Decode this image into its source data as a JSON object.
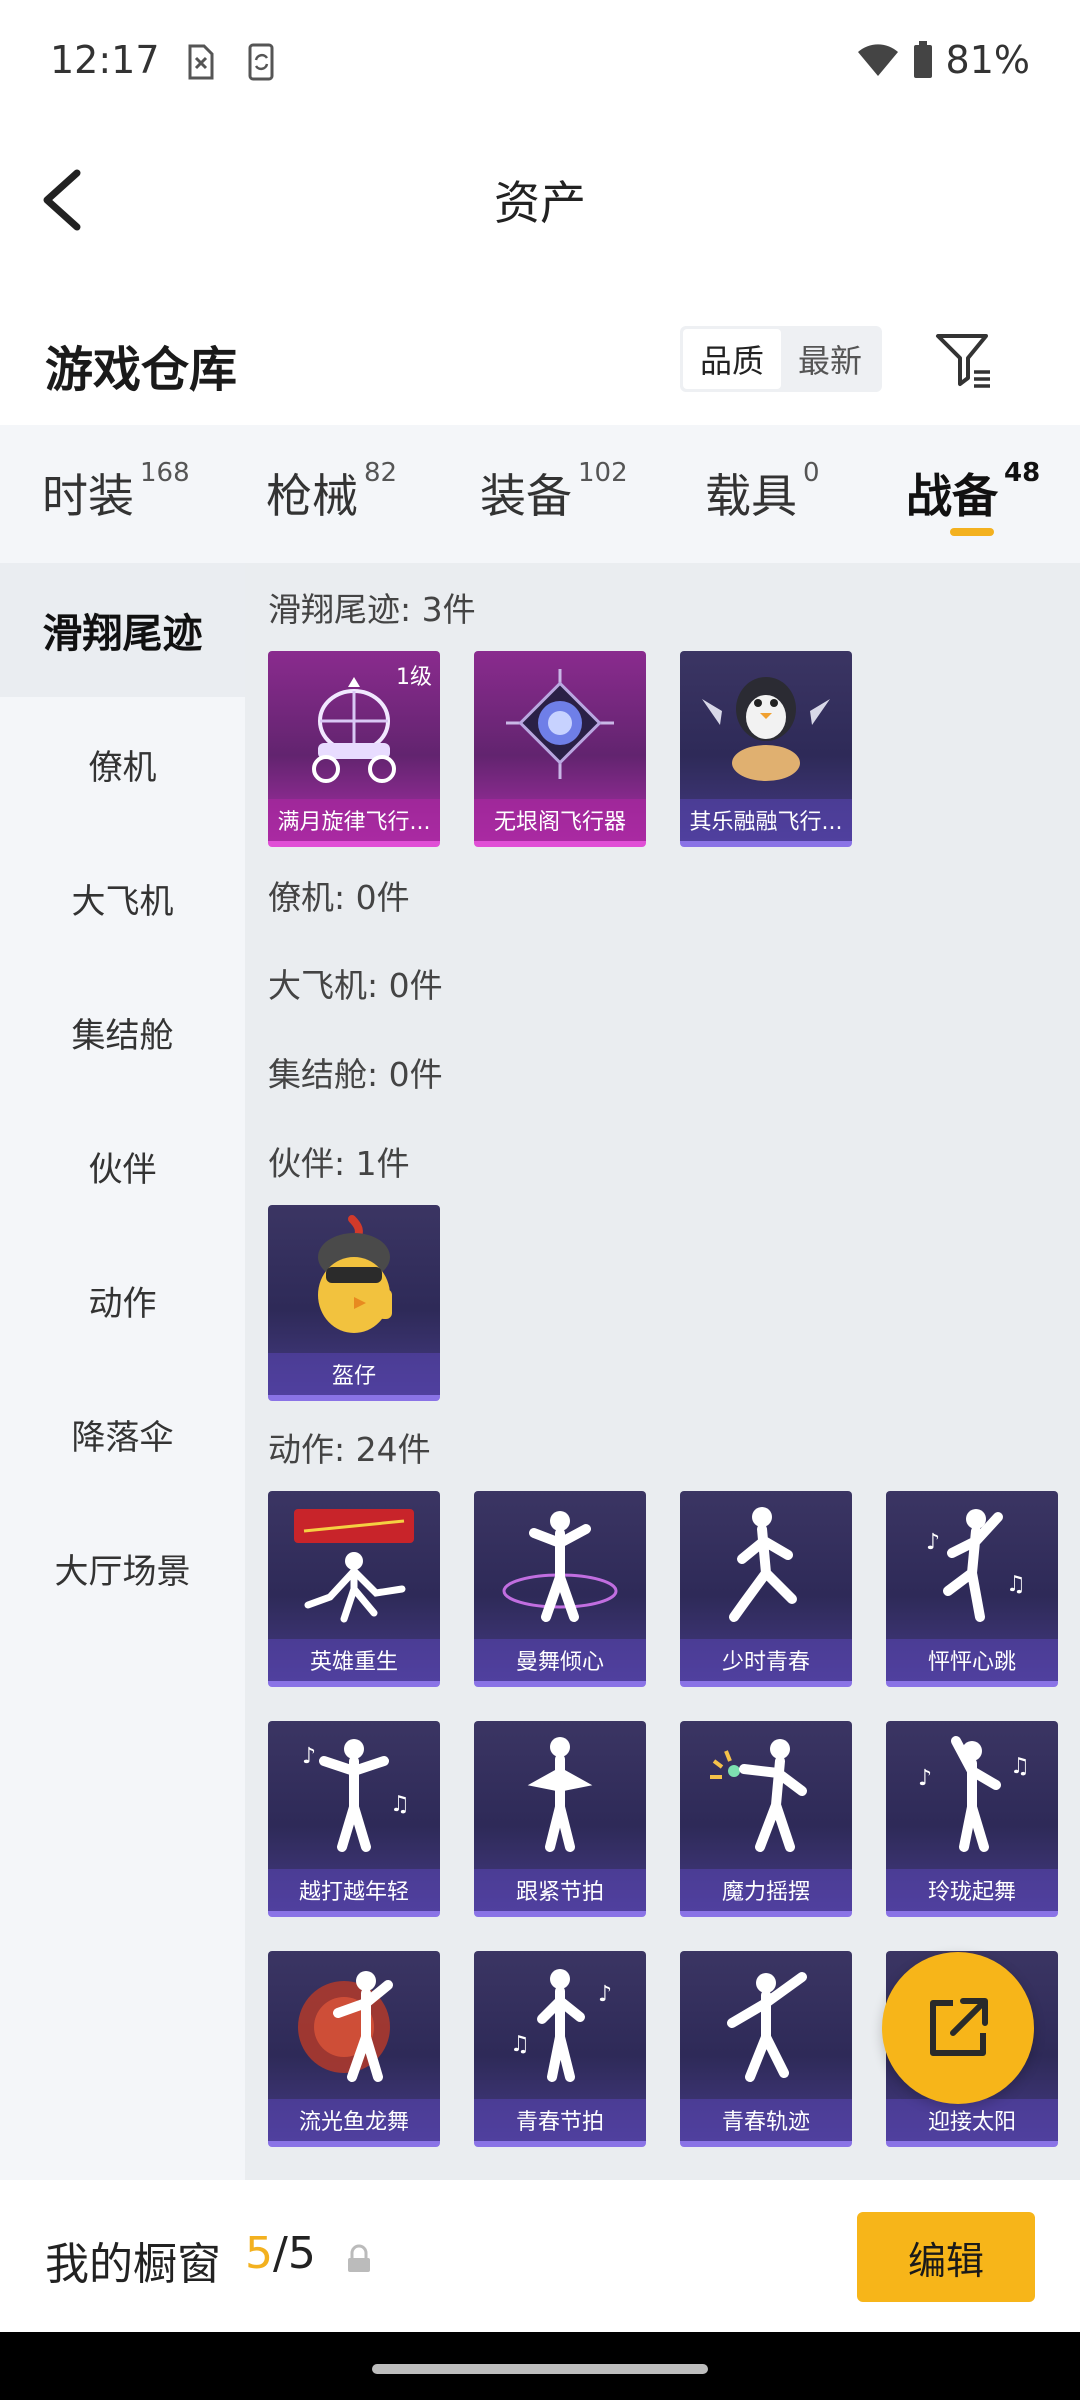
{
  "status_bar": {
    "time": "12:17",
    "battery": "81%"
  },
  "header": {
    "title": "资产"
  },
  "warehouse": {
    "title": "游戏仓库",
    "sort_options": [
      "品质",
      "最新"
    ]
  },
  "tabs": [
    {
      "label": "时装",
      "count": "168"
    },
    {
      "label": "枪械",
      "count": "82"
    },
    {
      "label": "装备",
      "count": "102"
    },
    {
      "label": "载具",
      "count": "0"
    },
    {
      "label": "战备",
      "count": "48"
    }
  ],
  "sidebar": [
    {
      "label": "滑翔尾迹"
    },
    {
      "label": "僚机"
    },
    {
      "label": "大飞机"
    },
    {
      "label": "集结舱"
    },
    {
      "label": "伙伴"
    },
    {
      "label": "动作"
    },
    {
      "label": "降落伞"
    },
    {
      "label": "大厅场景"
    }
  ],
  "sections": {
    "glide_trail": {
      "label": "滑翔尾迹: 3件",
      "items": [
        {
          "name": "满月旋律飞行...",
          "level": "1级",
          "icon": "carriage-icon"
        },
        {
          "name": "无垠阁飞行器",
          "icon": "compass-orb-icon"
        },
        {
          "name": "其乐融融飞行...",
          "icon": "penguin-icon"
        }
      ]
    },
    "wingman": {
      "label": "僚机: 0件"
    },
    "big_plane": {
      "label": "大飞机: 0件"
    },
    "capsule": {
      "label": "集结舱: 0件"
    },
    "partner": {
      "label": "伙伴: 1件",
      "items": [
        {
          "name": "盔仔",
          "icon": "chick-helmet-icon"
        }
      ]
    },
    "emote": {
      "label": "动作: 24件",
      "items": [
        {
          "name": "英雄重生",
          "icon": "hero-pose-icon"
        },
        {
          "name": "曼舞倾心",
          "icon": "dance-icon"
        },
        {
          "name": "少时青春",
          "icon": "dance-icon"
        },
        {
          "name": "怦怦心跳",
          "icon": "dance-icon"
        },
        {
          "name": "越打越年轻",
          "icon": "dance-icon"
        },
        {
          "name": "跟紧节拍",
          "icon": "dance-icon"
        },
        {
          "name": "魔力摇摆",
          "icon": "dance-icon"
        },
        {
          "name": "玲珑起舞",
          "icon": "dance-icon"
        },
        {
          "name": "流光鱼龙舞",
          "icon": "dance-icon"
        },
        {
          "name": "青春节拍",
          "icon": "dance-icon"
        },
        {
          "name": "青春轨迹",
          "icon": "dance-icon"
        },
        {
          "name": "迎接太阳",
          "icon": "dance-icon"
        }
      ]
    }
  },
  "showcase": {
    "label": "我的橱窗",
    "current": "5",
    "total": "/5",
    "edit_label": "编辑"
  },
  "colors": {
    "accent": "#f7b519",
    "purple_card": "#2e2a58",
    "pink_card": "#8a2b8e"
  }
}
